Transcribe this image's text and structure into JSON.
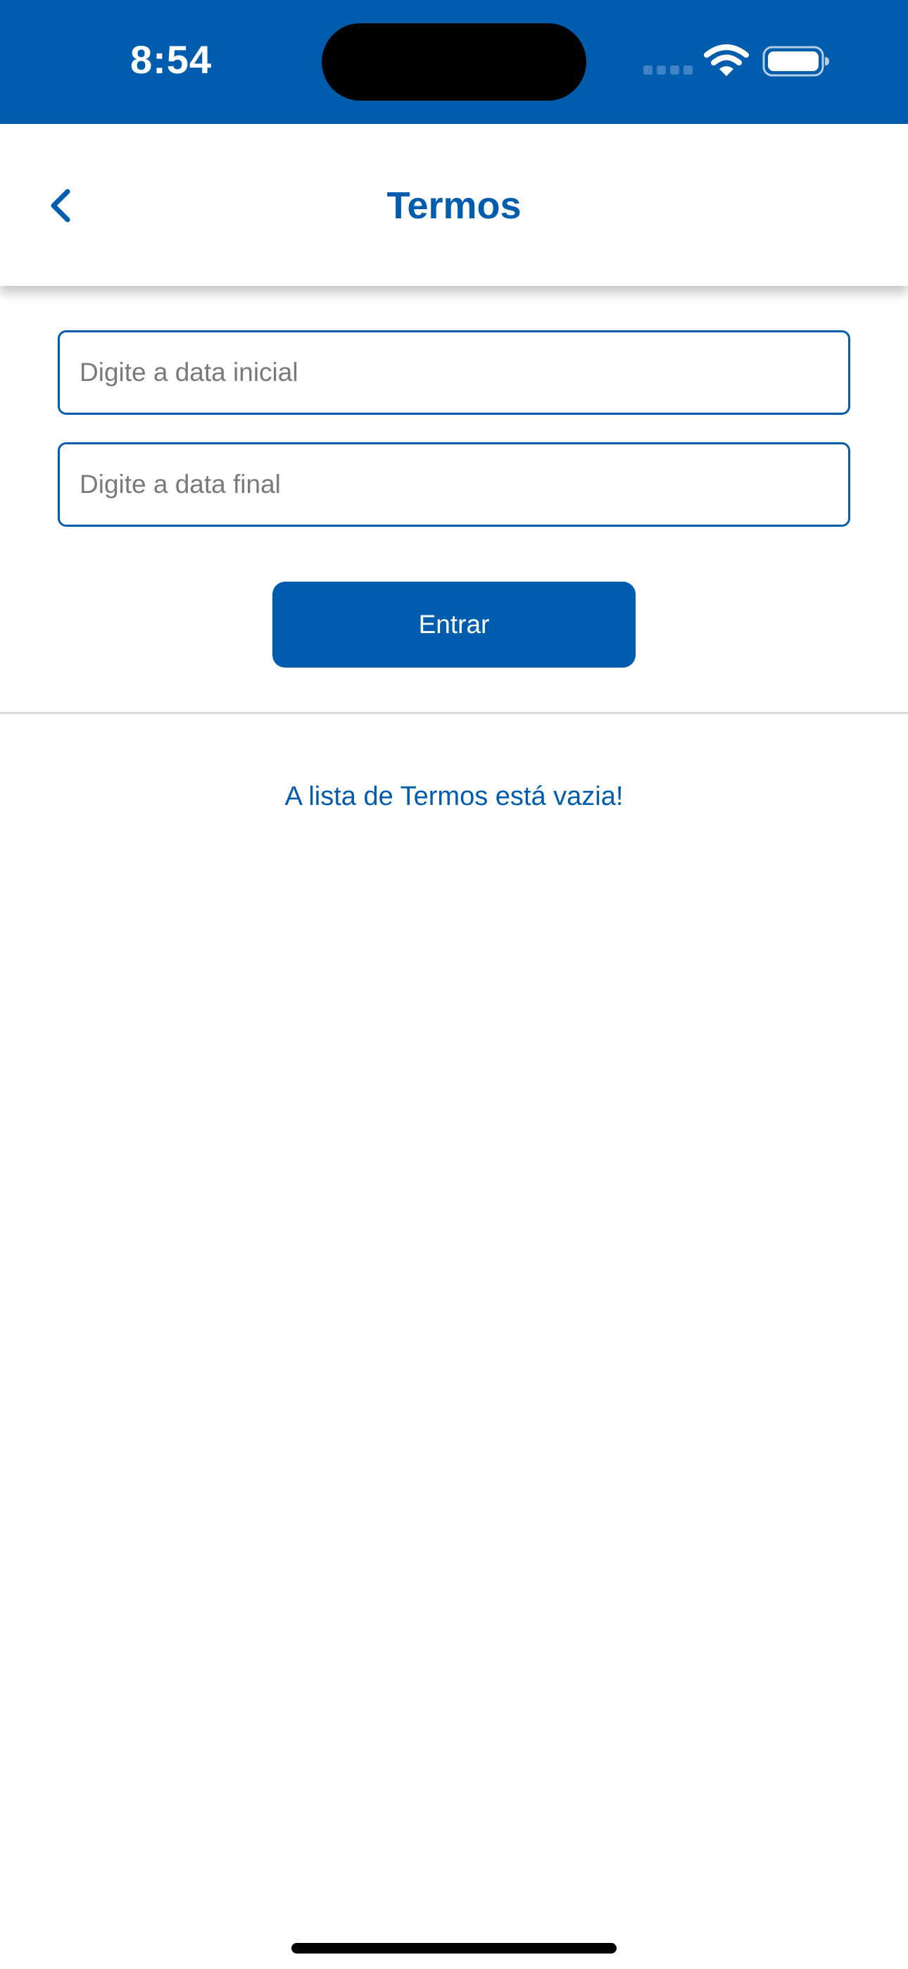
{
  "status_bar": {
    "time": "8:54",
    "background_color": "#005cac",
    "icons": [
      "signal-icon",
      "wifi-icon",
      "battery-icon"
    ]
  },
  "nav": {
    "title": "Termos",
    "back_icon": "chevron-left-icon"
  },
  "form": {
    "start_date": {
      "value": "",
      "placeholder": "Digite a data inicial"
    },
    "end_date": {
      "value": "",
      "placeholder": "Digite a data final"
    },
    "submit_label": "Entrar"
  },
  "list": {
    "empty_message": "A lista de Termos está vazia!"
  },
  "colors": {
    "primary": "#005cac",
    "background": "#ffffff",
    "divider": "#d9d9d9"
  }
}
